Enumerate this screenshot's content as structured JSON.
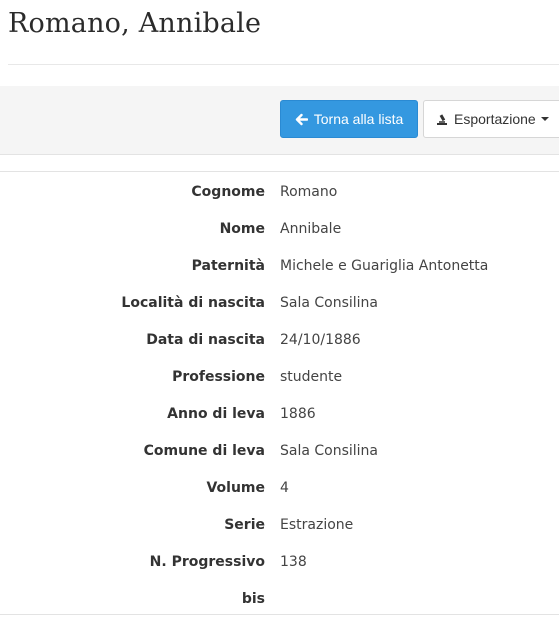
{
  "page": {
    "title": "Romano, Annibale"
  },
  "toolbar": {
    "back_button": {
      "label": "Torna alla lista",
      "icon": "arrow-left-icon"
    },
    "export_button": {
      "label": "Esportazione",
      "icon": "export-icon"
    }
  },
  "record": {
    "fields": [
      {
        "label": "Cognome",
        "value": "Romano"
      },
      {
        "label": "Nome",
        "value": "Annibale"
      },
      {
        "label": "Paternità",
        "value": "Michele e Guariglia Antonetta"
      },
      {
        "label": "Località di nascita",
        "value": "Sala Consilina"
      },
      {
        "label": "Data di nascita",
        "value": "24/10/1886"
      },
      {
        "label": "Professione",
        "value": "studente"
      },
      {
        "label": "Anno di leva",
        "value": "1886"
      },
      {
        "label": "Comune di leva",
        "value": "Sala Consilina"
      },
      {
        "label": "Volume",
        "value": "4"
      },
      {
        "label": "Serie",
        "value": "Estrazione"
      },
      {
        "label": "N. Progressivo",
        "value": "138"
      },
      {
        "label": "bis",
        "value": ""
      }
    ]
  },
  "colors": {
    "primary": "#3498e0",
    "toolbar_bg": "#f5f5f5"
  }
}
